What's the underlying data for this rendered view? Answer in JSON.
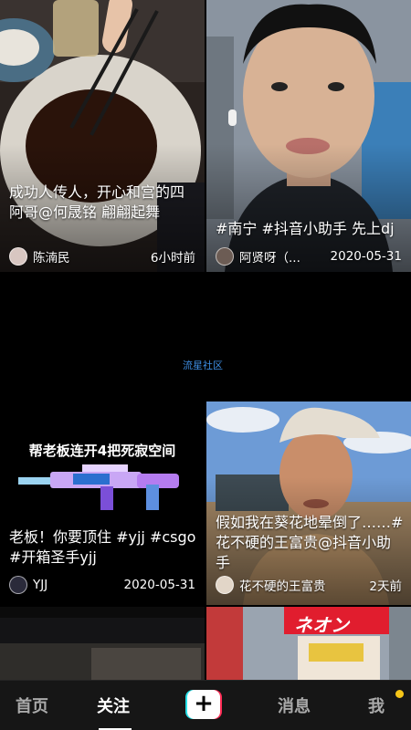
{
  "feed": {
    "items": [
      {
        "caption": "成功人传人，开心和宫的四阿哥@何晟铭 翩翩起舞",
        "author": "陈湳民",
        "time": "6小时前"
      },
      {
        "caption": "#南宁 #抖音小助手 先上dj",
        "author": "阿贤呀（...",
        "time": "2020-05-31"
      },
      {
        "banner": "帮老板连开4把死寂空间",
        "caption": "老板！你要顶住 #yjj #csgo #开箱圣手yjj",
        "author": "YJJ",
        "time": "2020-05-31"
      },
      {
        "caption": "假如我在葵花地晕倒了……#花不硬的王富贵@抖音小助手",
        "author": "花不硬的王富贵",
        "time": "2天前"
      }
    ],
    "center_label": "流星社区",
    "sign_text": "ネオン"
  },
  "nav": {
    "home": "首页",
    "follow": "关注",
    "plus": "+",
    "messages": "消息",
    "me": "我"
  },
  "colors": {
    "background": "#000000",
    "nav_bg": "#161616",
    "accent_cyan": "#27e0e8",
    "accent_red": "#fe2c55",
    "notification_dot": "#f5c518",
    "center_label": "#3e8ee3"
  }
}
